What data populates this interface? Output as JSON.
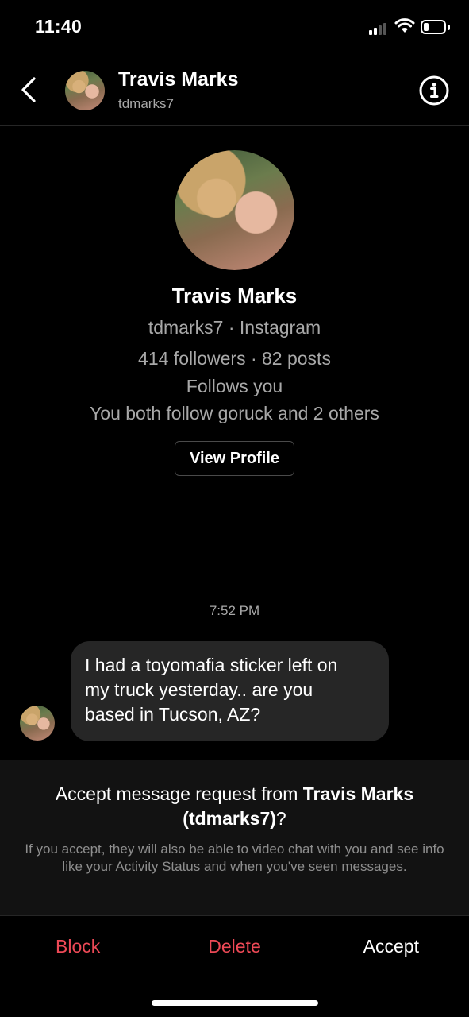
{
  "status_bar": {
    "time": "11:40"
  },
  "header": {
    "name": "Travis Marks",
    "username": "tdmarks7"
  },
  "profile": {
    "name": "Travis Marks",
    "source": "tdmarks7 · Instagram",
    "stats": "414 followers · 82 posts",
    "follows_you": "Follows you",
    "mutual": "You both follow goruck and 2 others",
    "view_button": "View Profile"
  },
  "thread": {
    "timestamp": "7:52 PM",
    "messages": [
      {
        "lines": [
          "I had a toyomafia sticker left on",
          "my truck yesterday.. are you",
          "based in Tucson, AZ?"
        ]
      }
    ]
  },
  "request": {
    "prefix": "Accept message request from ",
    "name": "Travis Marks",
    "handle": "(tdmarks7)",
    "suffix": "?",
    "description": "If you accept, they will also be able to video chat with you and see info like your Activity Status and when you've seen messages."
  },
  "actions": {
    "block": "Block",
    "delete": "Delete",
    "accept": "Accept"
  },
  "colors": {
    "danger": "#ed4956",
    "text": "#ffffff",
    "secondary": "#a8a8a8",
    "bubble": "#262626"
  }
}
